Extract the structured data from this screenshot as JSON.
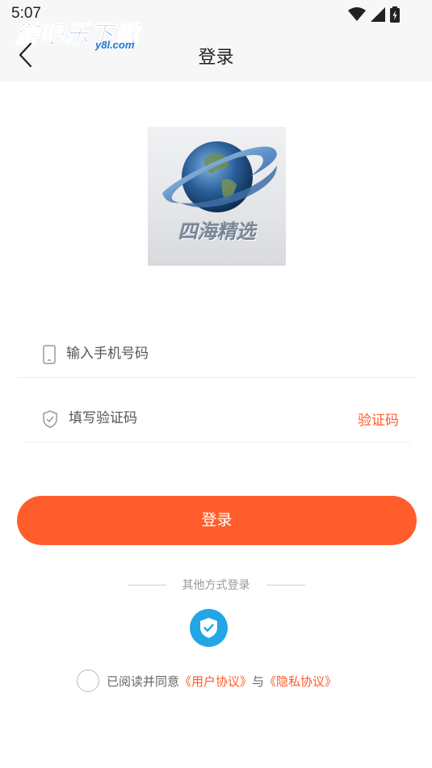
{
  "status_bar": {
    "time": "5:07",
    "icons": [
      "wifi-icon",
      "signal-icon",
      "battery-icon"
    ]
  },
  "watermark": {
    "main": "游吧乐下载",
    "sub": "y8l.com"
  },
  "header": {
    "title": "登录",
    "back_icon": "chevron-left-icon"
  },
  "logo": {
    "text": "四海精选"
  },
  "form": {
    "phone_placeholder": "输入手机号码",
    "phone_icon": "phone-icon",
    "code_placeholder": "填写验证码",
    "code_icon": "shield-icon",
    "get_code_label": "验证码"
  },
  "login_button": {
    "label": "登录"
  },
  "other_login": {
    "label": "其他方式登录",
    "method_icon": "shield-check-icon"
  },
  "agreement": {
    "prefix": "已阅读并同意",
    "user_agreement": "《用户协议》",
    "joiner": "与",
    "privacy_policy": "《隐私协议》"
  },
  "colors": {
    "accent": "#ff5e2c",
    "alt_login": "#24a6e6",
    "header_bg": "#f7f7f7"
  }
}
